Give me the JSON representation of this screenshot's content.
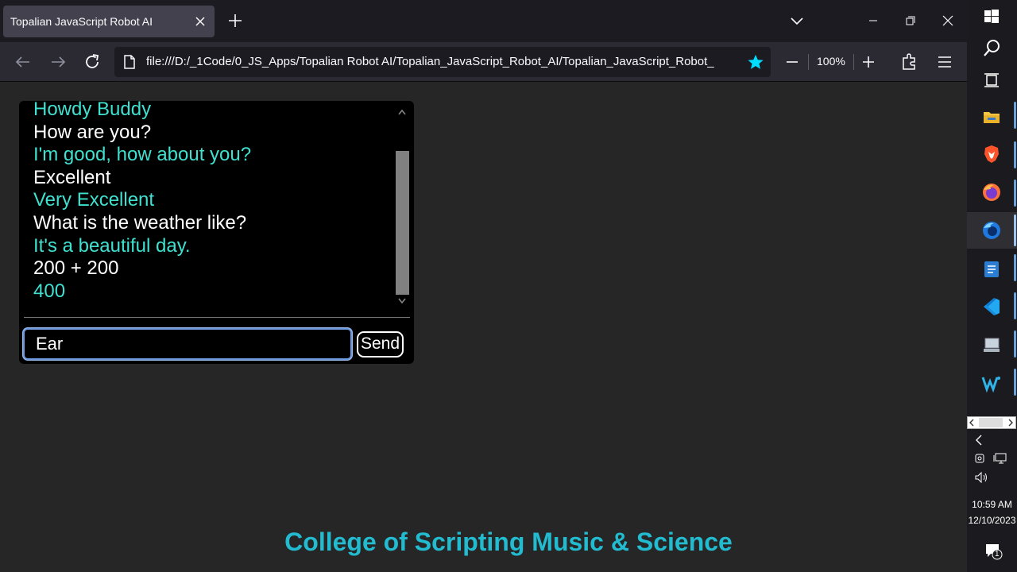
{
  "browser": {
    "tab_title": "Topalian JavaScript Robot AI",
    "url": "file:///D:/_1Code/0_JS_Apps/Topalian Robot AI/Topalian_JavaScript_Robot_AI/Topalian_JavaScript_Robot_",
    "zoom": "100%"
  },
  "chat": {
    "messages": [
      {
        "text": "Howdy Buddy",
        "from": "bot"
      },
      {
        "text": "How are you?",
        "from": "user"
      },
      {
        "text": "I'm good, how about you?",
        "from": "bot"
      },
      {
        "text": "Excellent",
        "from": "user"
      },
      {
        "text": "Very Excellent",
        "from": "bot"
      },
      {
        "text": "What is the weather like?",
        "from": "user"
      },
      {
        "text": "It's a beautiful day.",
        "from": "bot"
      },
      {
        "text": "200 + 200",
        "from": "user"
      },
      {
        "text": "400",
        "from": "bot"
      }
    ],
    "input_value": "Ear",
    "send_label": "Send"
  },
  "footer": {
    "text": "College of Scripting Music & Science"
  },
  "taskbar": {
    "time": "10:59 AM",
    "date": "12/10/2023",
    "notification_count": "1"
  },
  "colors": {
    "bot_text": "#40e0d0",
    "user_text": "#ffffff",
    "footer": "#22bbcf",
    "input_focus": "#6e9be0"
  },
  "icons": [
    "windows-start-icon",
    "search-icon",
    "task-view-icon",
    "file-explorer-icon",
    "brave-icon",
    "firefox-icon",
    "firefox-developer-icon",
    "writer-icon",
    "vscode-icon",
    "computer-icon",
    "wix-icon"
  ]
}
